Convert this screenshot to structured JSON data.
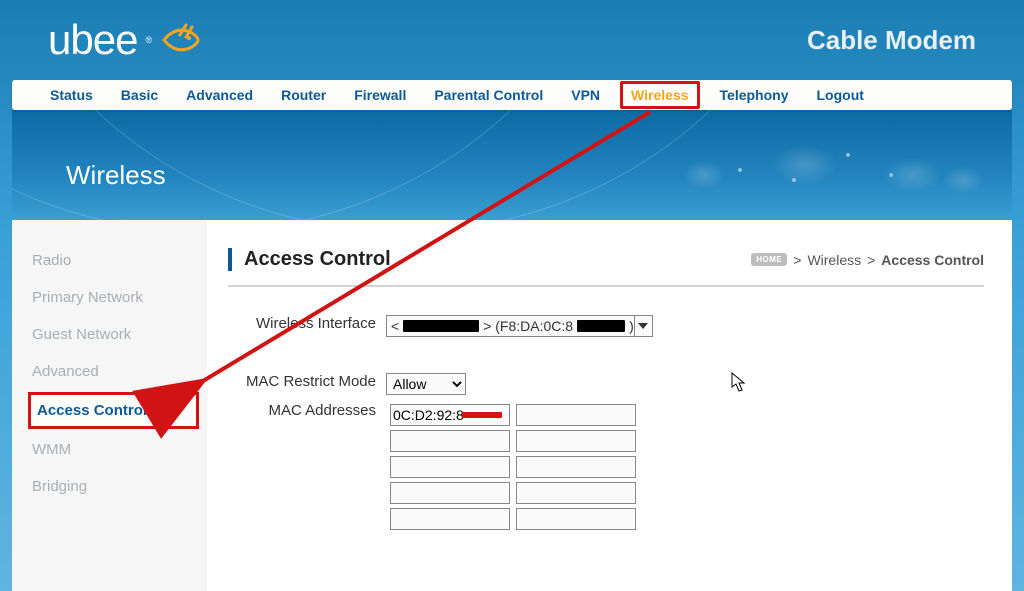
{
  "header": {
    "brand": "ubee",
    "device_name": "Cable Modem"
  },
  "topnav": {
    "items": [
      {
        "label": "Status"
      },
      {
        "label": "Basic"
      },
      {
        "label": "Advanced"
      },
      {
        "label": "Router"
      },
      {
        "label": "Firewall"
      },
      {
        "label": "Parental Control"
      },
      {
        "label": "VPN"
      },
      {
        "label": "Wireless",
        "active": true
      },
      {
        "label": "Telephony"
      },
      {
        "label": "Logout"
      }
    ]
  },
  "banner": {
    "title": "Wireless"
  },
  "sidebar": {
    "items": [
      {
        "label": "Radio"
      },
      {
        "label": "Primary Network"
      },
      {
        "label": "Guest Network"
      },
      {
        "label": "Advanced"
      },
      {
        "label": "Access Control",
        "active": true
      },
      {
        "label": "WMM"
      },
      {
        "label": "Bridging"
      }
    ]
  },
  "breadcrumb": {
    "home": "HOME",
    "sep": ">",
    "part1": "Wireless",
    "part2": "Access Control"
  },
  "main": {
    "title": "Access Control",
    "wireless_interface_label": "Wireless Interface",
    "wireless_interface_visible_prefix": "< ",
    "wireless_interface_visible_mid": " > (F8:DA:0C:8",
    "wireless_interface_visible_suffix": ")",
    "mac_restrict_label": "MAC Restrict Mode",
    "mac_restrict_options": [
      "Allow"
    ],
    "mac_restrict_selected": "Allow",
    "mac_addresses_label": "MAC Addresses",
    "mac_rows": 5,
    "mac_values": [
      [
        "0C:D2:92:8",
        ""
      ],
      [
        "",
        ""
      ],
      [
        "",
        ""
      ],
      [
        "",
        ""
      ],
      [
        "",
        ""
      ]
    ]
  }
}
